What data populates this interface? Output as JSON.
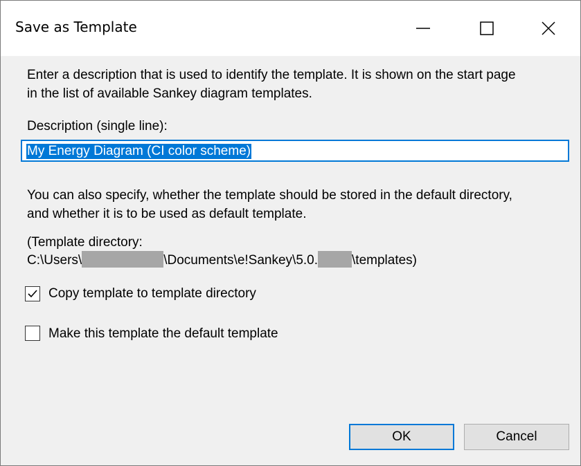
{
  "window": {
    "title": "Save as Template",
    "icons": {
      "minimize": "minimize-icon",
      "maximize": "maximize-icon",
      "close": "close-icon"
    }
  },
  "intro": {
    "line1": "Enter a description that is used to identify the template. It is shown on the start page",
    "line2": "in the list of available Sankey diagram templates."
  },
  "description": {
    "label": "Description (single line):",
    "value": "My Energy Diagram (CI color scheme)"
  },
  "info": {
    "line1": "You can also specify, whether the template should be stored in the default directory,",
    "line2": "and whether it is to be used as default template."
  },
  "directory": {
    "label": "(Template directory:",
    "path_part1": "C:\\Users\\",
    "path_part2": "\\Documents\\e!Sankey\\5.0.",
    "path_part3": "\\templates)"
  },
  "options": {
    "copy_label": "Copy template to template directory",
    "copy_checked": true,
    "default_label": "Make this template the default template",
    "default_checked": false
  },
  "buttons": {
    "ok": "OK",
    "cancel": "Cancel"
  },
  "colors": {
    "accent": "#0078d7",
    "window_bg": "#f0f0f0",
    "redaction": "#a6a6a6"
  }
}
